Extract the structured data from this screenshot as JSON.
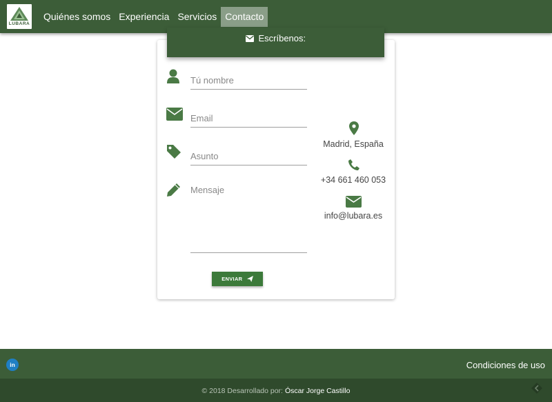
{
  "brand": {
    "logo_text": "LUBARA"
  },
  "nav": {
    "items": [
      {
        "label": "Quiénes somos"
      },
      {
        "label": "Experiencia"
      },
      {
        "label": "Servicios"
      },
      {
        "label": "Contacto",
        "active": true
      }
    ]
  },
  "contact_form": {
    "header": "Escríbenos:",
    "name_placeholder": "Tú nombre",
    "email_placeholder": "Email",
    "subject_placeholder": "Asunto",
    "message_placeholder": "Mensaje",
    "send_label": "ENVIAR"
  },
  "contact_info": {
    "location": "Madrid, España",
    "phone": "+34 661 460 053",
    "email": "info@lubara.es"
  },
  "footer": {
    "linkedin_label": "in",
    "terms_label": "Condiciones de uso",
    "copyright_prefix": "© 2018 Desarrollado por:",
    "author": "Óscar Jorge Castillo"
  },
  "colors": {
    "primary": "#3c5d38",
    "primary_dark": "#2f4a2c",
    "active_nav": "#8a9e88",
    "button": "#3c7a3a",
    "icon": "#4a7a45",
    "linkedin": "#1f7fc4"
  }
}
